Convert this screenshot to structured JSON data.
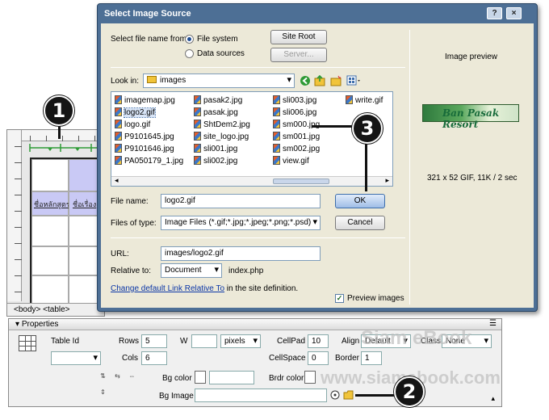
{
  "designer": {
    "thai_cells": [
      "ชื่อหลักสูตร",
      "ชื่อเรื่อง"
    ],
    "tag_selector": "<body> <table>"
  },
  "dialog": {
    "title": "Select Image Source",
    "title_buttons": [
      "?",
      "×"
    ],
    "select_from_label": "Select file name from:",
    "source_options": [
      {
        "label": "File system",
        "selected": true
      },
      {
        "label": "Data sources",
        "selected": false
      }
    ],
    "site_root_button": "Site Root",
    "server_button": "Server...",
    "look_in_label": "Look in:",
    "look_in_value": "images",
    "files": [
      [
        "imagemap.jpg",
        "logo2.gif",
        "logo.gif",
        "P9101645.jpg",
        "P9101646.jpg",
        "PA050179_1.jpg"
      ],
      [
        "pasak2.jpg",
        "pasak.jpg",
        "ShtDem2.jpg",
        "site_logo.jpg",
        "sli001.jpg",
        "sli002.jpg"
      ],
      [
        "sli003.jpg",
        "sli006.jpg",
        "sm000.jpg",
        "sm001.jpg",
        "sm002.jpg",
        "view.gif"
      ],
      [
        "write.gif"
      ]
    ],
    "selected_file": "logo2.gif",
    "file_name_label": "File name:",
    "file_name_value": "logo2.gif",
    "files_of_type_label": "Files of type:",
    "files_of_type_value": "Image Files (*.gif;*.jpg;*.jpeg;*.png;*.psd)",
    "ok_button": "OK",
    "cancel_button": "Cancel",
    "url_label": "URL:",
    "url_value": "images/logo2.gif",
    "relative_to_label": "Relative to:",
    "relative_to_value": "Document",
    "relative_to_file": "index.php",
    "change_link_text": "Change default Link Relative To",
    "change_link_suffix": " in the site definition.",
    "preview_title": "Image preview",
    "preview_image_text": "Ban Pasak Resort",
    "preview_info": "321 x 52 GIF, 11K / 2 sec",
    "preview_checkbox_label": "Preview images",
    "preview_checked": true
  },
  "properties": {
    "title": "Properties",
    "table_id_label": "Table Id",
    "rows_label": "Rows",
    "rows_value": "5",
    "cols_label": "Cols",
    "cols_value": "6",
    "w_label": "W",
    "w_value": "",
    "w_unit": "pixels",
    "cellpad_label": "CellPad",
    "cellpad_value": "10",
    "cellspace_label": "CellSpace",
    "cellspace_value": "0",
    "align_label": "Align",
    "align_value": "Default",
    "class_label": "Class",
    "class_value": "None",
    "border_label": "Border",
    "border_value": "1",
    "bgcolor_label": "Bg color",
    "brdrcolor_label": "Brdr color",
    "bgimage_label": "Bg Image"
  },
  "watermark": {
    "brand": "Siam eBook",
    "url": "www.siamebook.com"
  },
  "callouts": [
    "1",
    "2",
    "3"
  ]
}
